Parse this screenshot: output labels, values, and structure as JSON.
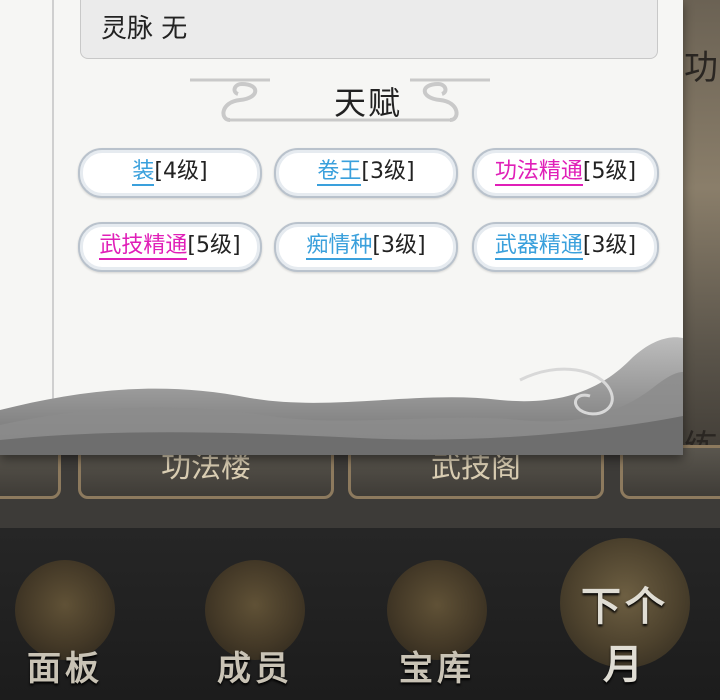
{
  "info": {
    "spirit_vein": "灵脉 无"
  },
  "section_title": "天赋",
  "talents": [
    {
      "name": "装",
      "level": "[4级]",
      "color": "#3aa0dc"
    },
    {
      "name": "卷王",
      "level": "[3级]",
      "color": "#3aa0dc"
    },
    {
      "name": "功法精通",
      "level": "[5级]",
      "color": "#e01fb8"
    },
    {
      "name": "武技精通",
      "level": "[5级]",
      "color": "#e01fb8"
    },
    {
      "name": "痴情种",
      "level": "[3级]",
      "color": "#3aa0dc"
    },
    {
      "name": "武器精通",
      "level": "[3级]",
      "color": "#3aa0dc"
    }
  ],
  "background": {
    "right_chars": [
      "功",
      "练"
    ],
    "mid_buttons": [
      "功法楼",
      "武技阁",
      ""
    ]
  },
  "nav": {
    "items": [
      {
        "label": "面板",
        "icon": "scroll-emblem-icon"
      },
      {
        "label": "成员",
        "icon": "member-portrait-icon"
      },
      {
        "label": "宝库",
        "icon": "yin-yang-icon"
      },
      {
        "label": "下个月",
        "icon": "spiral-emblem-icon"
      }
    ]
  }
}
